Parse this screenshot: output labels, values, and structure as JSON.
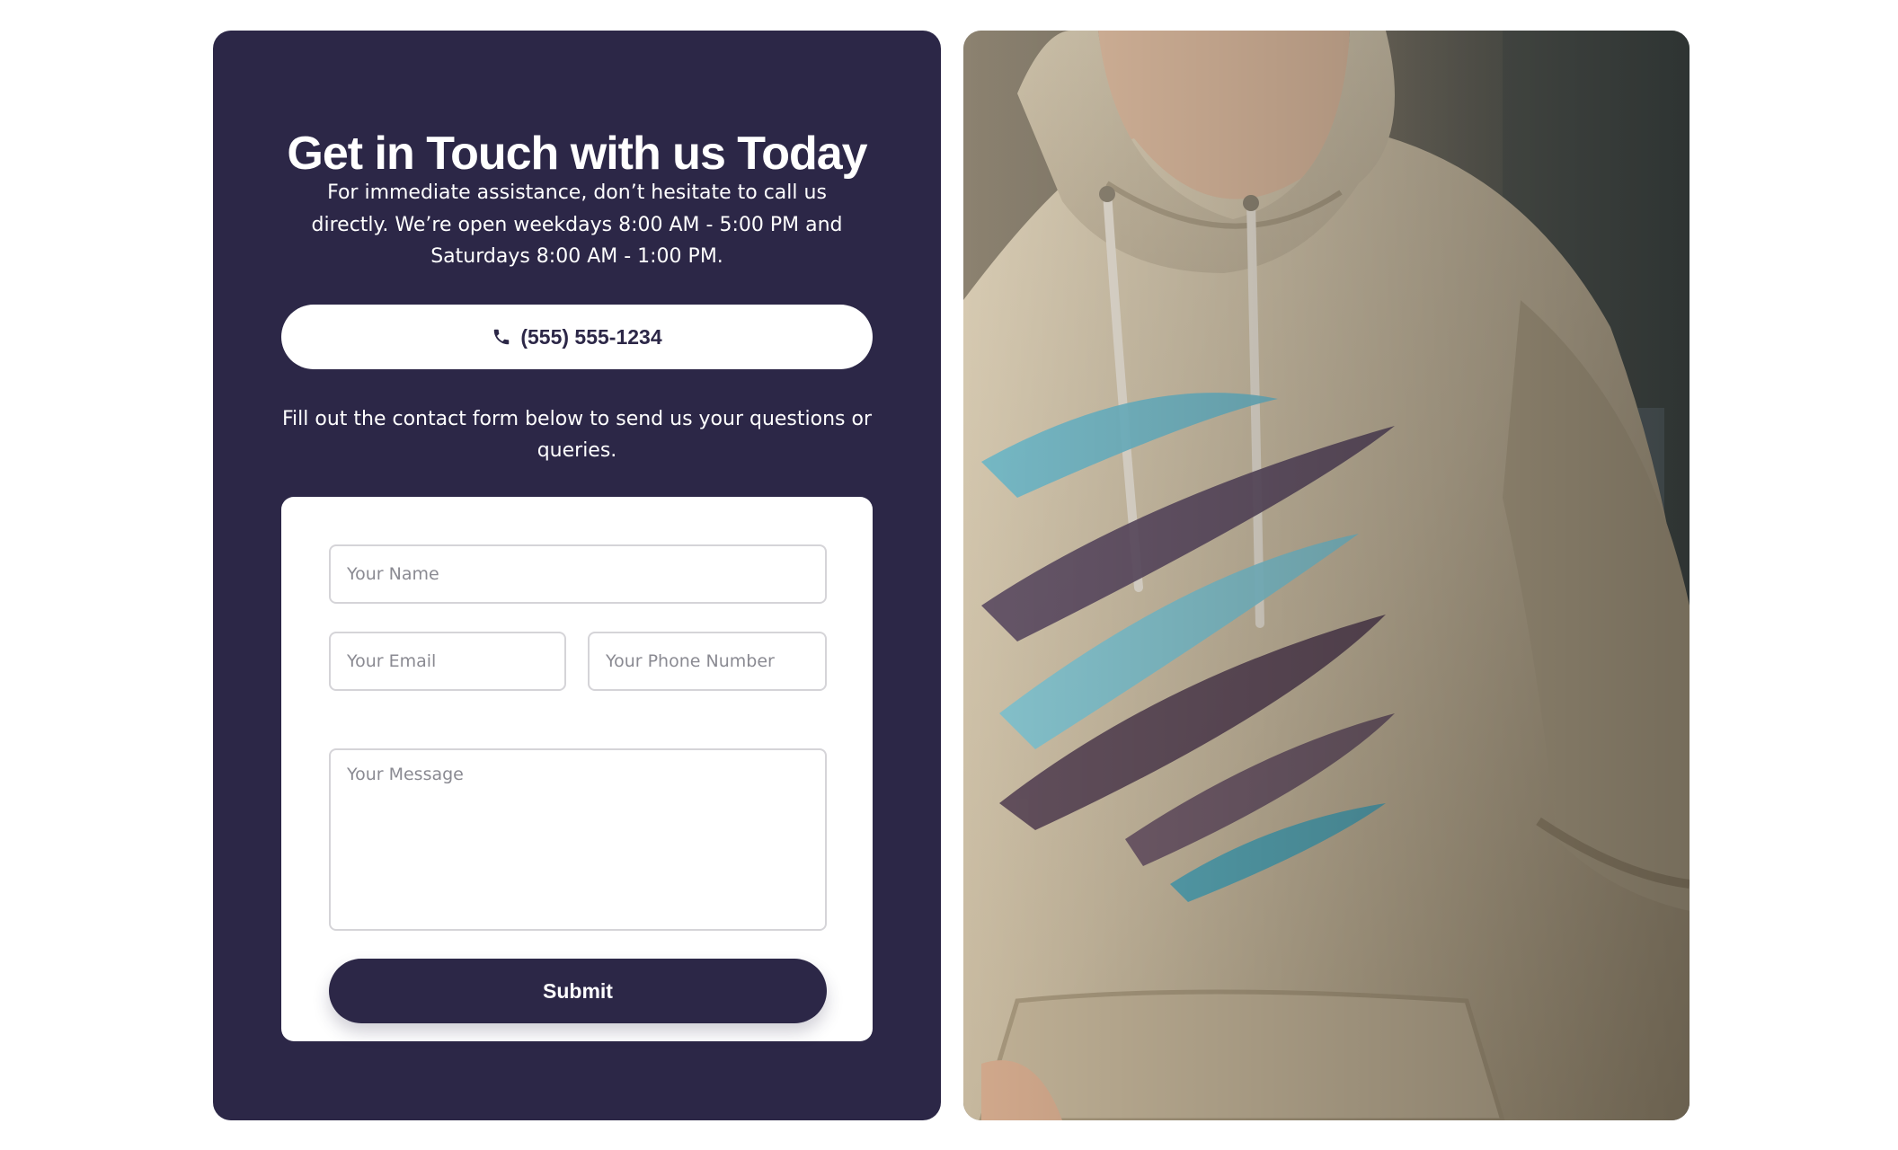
{
  "contact": {
    "title": "Get in Touch with us Today",
    "intro": "For immediate assistance, don’t hesitate to call us directly. We’re open weekdays 8:00 AM - 5:00 PM and Saturdays 8:00 AM - 1:00 PM.",
    "phone_label": "(555) 555-1234",
    "phone_icon": "phone-icon",
    "form_intro": "Fill out the contact form below to send us your questions or queries."
  },
  "form": {
    "name_placeholder": "Your Name",
    "email_placeholder": "Your Email",
    "phone_placeholder": "Your Phone Number",
    "message_placeholder": "Your Message",
    "submit_label": "Submit"
  },
  "colors": {
    "card_background": "#2c2747",
    "button_text": "#2c2747",
    "panel_background": "#ffffff"
  }
}
